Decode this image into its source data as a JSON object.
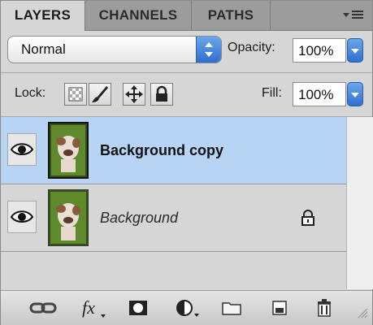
{
  "tabs": [
    {
      "label": "LAYERS",
      "active": true
    },
    {
      "label": "CHANNELS",
      "active": false
    },
    {
      "label": "PATHS",
      "active": false
    }
  ],
  "blend_mode": {
    "value": "Normal"
  },
  "opacity": {
    "label": "Opacity:",
    "value": "100%"
  },
  "lock": {
    "label": "Lock:",
    "icons": [
      "lock-transparent-pixels-icon",
      "lock-image-pixels-icon",
      "lock-position-icon",
      "lock-all-icon"
    ]
  },
  "fill": {
    "label": "Fill:",
    "value": "100%"
  },
  "layers": [
    {
      "name": "Background copy",
      "selected": true,
      "visible": true,
      "locked": false
    },
    {
      "name": "Background",
      "selected": false,
      "visible": true,
      "locked": true
    }
  ],
  "bottom_icons": [
    "link-layers-icon",
    "fx-icon",
    "add-mask-icon",
    "adjustment-layer-icon",
    "new-group-icon",
    "new-layer-icon",
    "delete-layer-icon"
  ],
  "colors": {
    "selection": "#b7d4f5",
    "accent": "#2f6fcf"
  }
}
